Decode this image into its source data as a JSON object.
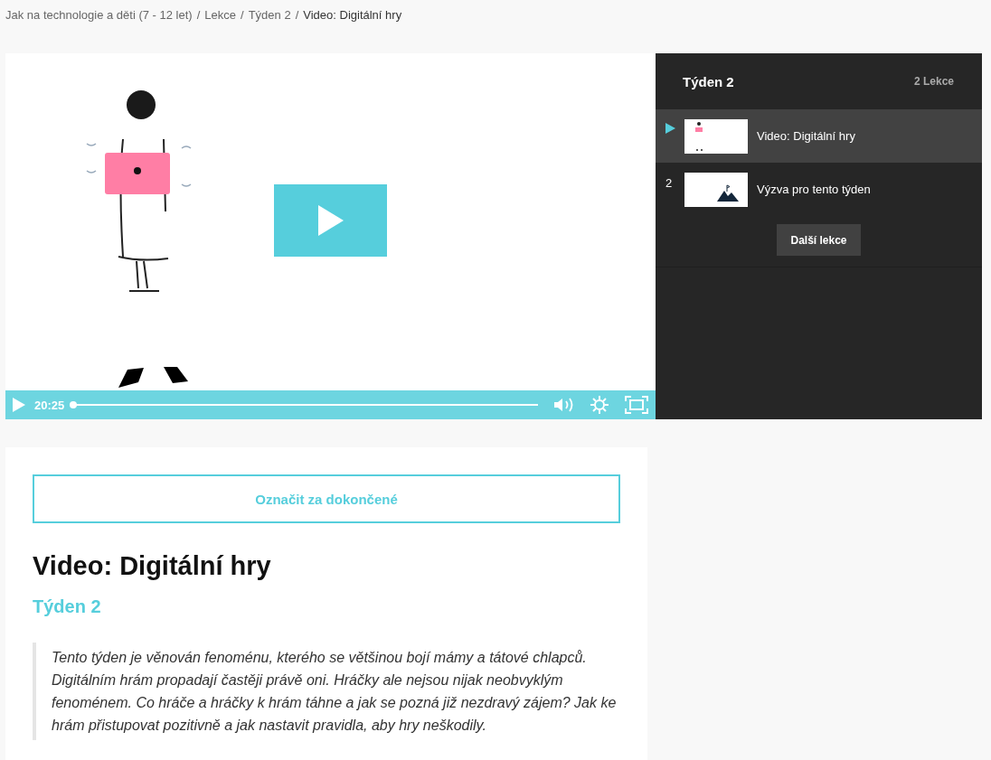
{
  "breadcrumb": {
    "separator": "/",
    "items": [
      {
        "label": "Jak na technologie a děti (7 - 12 let)",
        "current": false
      },
      {
        "label": "Lekce",
        "current": false
      },
      {
        "label": "Týden 2",
        "current": false
      },
      {
        "label": "Video: Digitální hry",
        "current": true
      }
    ]
  },
  "player": {
    "time": "20:25",
    "level": 0
  },
  "playlist": {
    "title": "Týden 2",
    "count": "2 Lekce",
    "lessons": [
      {
        "title": "Video: Digitální hry",
        "selected": true,
        "kind": "figure"
      },
      {
        "title": "Výzva pro tento týden",
        "selected": false,
        "number": "2",
        "kind": "mountain"
      }
    ],
    "next_button": "Další lekce"
  },
  "content": {
    "complete_button": "Označit za dokončené",
    "title": "Video: Digitální hry",
    "subtitle": "Týden 2",
    "quote": "Tento týden je věnován fenoménu, kterého se většinou bojí mámy a tátové chlapců. Digitálním hrám propadají častěji právě oni. Hráčky ale nejsou nijak neobvyklým fenoménem. Co hráče a hráčky k hrám táhne a jak se pozná již nezdravý zájem? Jak ke hrám přistupovat pozitivně a jak nastavit pravidla, aby hry neškodily."
  }
}
